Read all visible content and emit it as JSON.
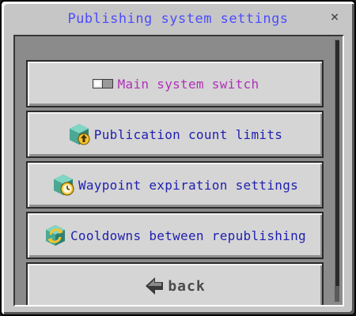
{
  "window": {
    "title": "Publishing system settings",
    "close_label": "×"
  },
  "menu": {
    "items": [
      {
        "label": "Main system switch",
        "icon": "toggle-switch-icon",
        "color": "#b030b8"
      },
      {
        "label": "Publication count limits",
        "icon": "cube-arrow-up-icon",
        "color": "#1f1fb0"
      },
      {
        "label": "Waypoint expiration settings",
        "icon": "cube-clock-icon",
        "color": "#1f1fb0"
      },
      {
        "label": "Cooldowns between republishing",
        "icon": "cycle-arrows-icon",
        "color": "#1f1fb0"
      }
    ],
    "back_label": "back",
    "back_icon": "left-arrow-icon"
  }
}
